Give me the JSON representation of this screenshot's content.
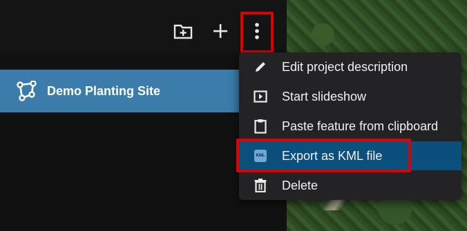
{
  "toolbar": {
    "new_folder_icon": "folder-plus-icon",
    "add_icon": "plus-icon",
    "more_icon": "more-vert-icon"
  },
  "project": {
    "name": "Demo Planting Site",
    "icon": "polygon-icon"
  },
  "menu": {
    "items": [
      {
        "label": "Edit project description",
        "icon": "pencil-icon"
      },
      {
        "label": "Start slideshow",
        "icon": "slideshow-icon"
      },
      {
        "label": "Paste feature from clipboard",
        "icon": "clipboard-icon"
      },
      {
        "label": "Export as KML file",
        "icon": "kml-file-icon",
        "badge": "KML",
        "active": true
      },
      {
        "label": "Delete",
        "icon": "trash-icon"
      }
    ]
  },
  "colors": {
    "accent": "#3c7cab",
    "menu_active": "#0b4f7d",
    "highlight_border": "#e10000"
  }
}
